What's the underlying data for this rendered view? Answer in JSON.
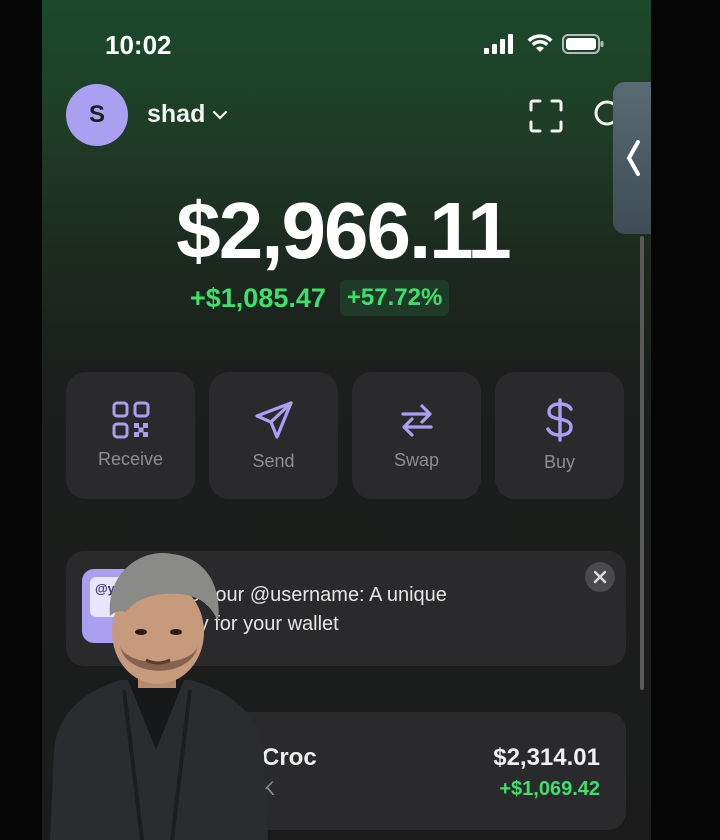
{
  "status": {
    "time": "10:02"
  },
  "header": {
    "avatar_letter": "S",
    "account_name": "shad"
  },
  "balance": {
    "total": "$2,966.11",
    "change_amount": "+$1,085.47",
    "change_percent": "+57.72%"
  },
  "actions": [
    {
      "label": "Receive",
      "icon": "qr-code-icon"
    },
    {
      "label": "Send",
      "icon": "send-icon"
    },
    {
      "label": "Swap",
      "icon": "swap-icon"
    },
    {
      "label": "Buy",
      "icon": "dollar-icon"
    }
  ],
  "banner": {
    "image_text": "@y",
    "line1": "ate your @username: A unique",
    "line2": "ntity for your wallet"
  },
  "token": {
    "name": "Croc",
    "sub": "K",
    "value": "$2,314.01",
    "change": "+$1,069.42"
  },
  "colors": {
    "accent": "#ab9ff2",
    "positive": "#3ee06b",
    "card": "#2a2a2c"
  }
}
